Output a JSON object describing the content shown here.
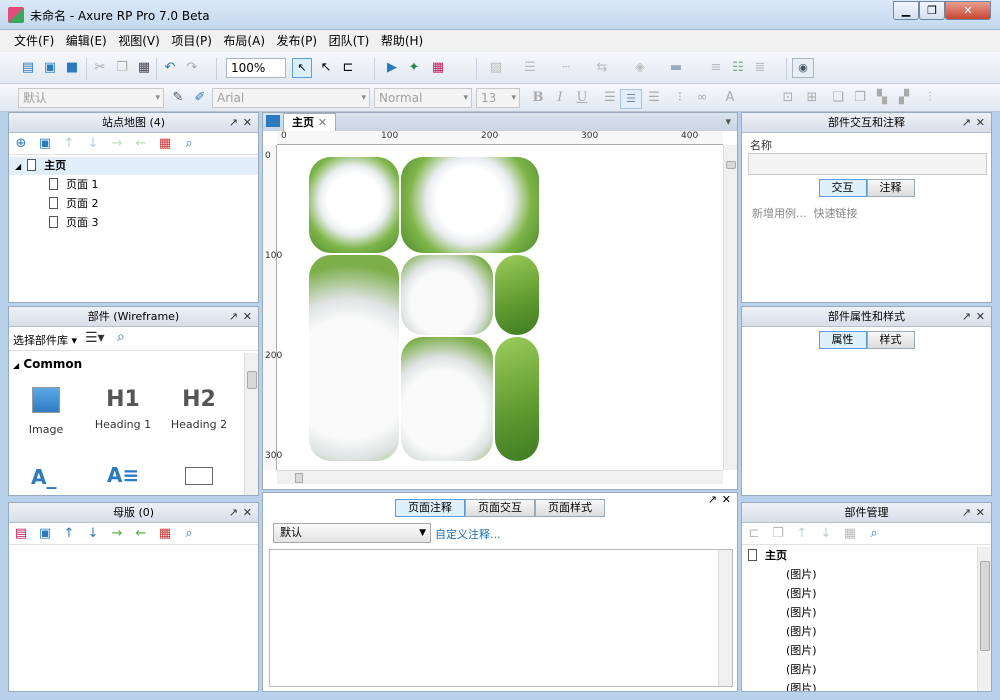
{
  "window": {
    "title": "未命名 - Axure RP Pro 7.0 Beta",
    "minimize": "▁",
    "restore": "❐",
    "close": "✕"
  },
  "menu": [
    "文件(F)",
    "编辑(E)",
    "视图(V)",
    "项目(P)",
    "布局(A)",
    "发布(P)",
    "团队(T)",
    "帮助(H)"
  ],
  "toolbar": {
    "zoom": "100%",
    "style_select": "默认",
    "font": "Arial",
    "font_weight": "Normal",
    "font_size": "13"
  },
  "sitemap": {
    "title": "站点地图 (4)",
    "root": "主页",
    "pages": [
      "页面 1",
      "页面 2",
      "页面 3"
    ]
  },
  "widgets": {
    "title": "部件 (Wireframe)",
    "library_select": "选择部件库",
    "section": "Common",
    "items": [
      {
        "label": "Image"
      },
      {
        "label": "Heading 1",
        "glyph": "H1"
      },
      {
        "label": "Heading 2",
        "glyph": "H2"
      }
    ]
  },
  "masters": {
    "title": "母版 (0)"
  },
  "canvas": {
    "tab": "主页",
    "ruler_x": [
      "0",
      "100",
      "200",
      "300",
      "400"
    ],
    "ruler_y": [
      "0",
      "100",
      "200",
      "300"
    ]
  },
  "page_notes": {
    "tabs": [
      "页面注释",
      "页面交互",
      "页面样式"
    ],
    "select": "默认",
    "custom_link": "自定义注释..."
  },
  "interactions": {
    "title": "部件交互和注释",
    "name_label": "名称",
    "tabs": [
      "交互",
      "注释"
    ],
    "hint": "新增用例...",
    "quick_link": "快速链接"
  },
  "properties": {
    "title": "部件属性和样式",
    "tabs": [
      "属性",
      "样式"
    ]
  },
  "manager": {
    "title": "部件管理",
    "root": "主页",
    "items": [
      "(图片)",
      "(图片)",
      "(图片)",
      "(图片)",
      "(图片)",
      "(图片)",
      "(图片)"
    ]
  },
  "colors": {
    "accent": "#5f9dd6",
    "link": "#1c6fb5"
  }
}
